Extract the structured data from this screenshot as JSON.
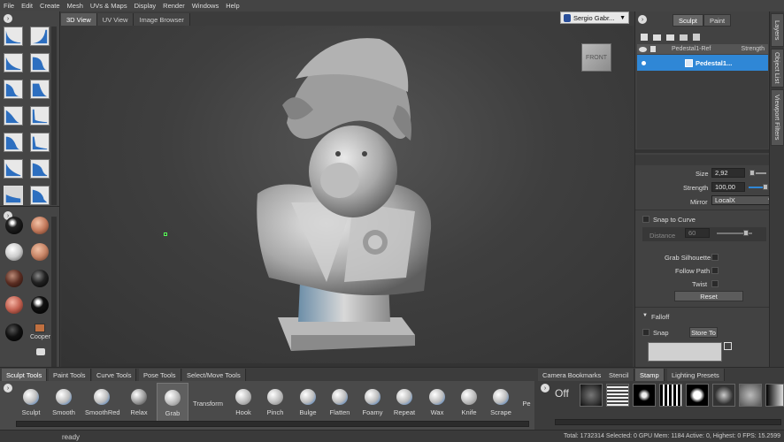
{
  "menu": [
    "File",
    "Edit",
    "Create",
    "Mesh",
    "UVs & Maps",
    "Display",
    "Render",
    "Windows",
    "Help"
  ],
  "view_tabs": [
    "3D View",
    "UV View",
    "Image Browser"
  ],
  "user": {
    "name": "Sergio Gabr..."
  },
  "viewcube": {
    "label": "FRONT"
  },
  "right_tabs": [
    "Sculpt",
    "Paint"
  ],
  "side_tabs": [
    "Layers",
    "Object List",
    "Viewport Filters"
  ],
  "layers": {
    "header_name": "Pedestal1-Ref",
    "header_strength": "Strength",
    "item": "Pedestal1..."
  },
  "props": {
    "size_label": "Size",
    "size_value": "2,92",
    "strength_label": "Strength",
    "strength_value": "100,00",
    "mirror_label": "Mirror",
    "mirror_value": "LocalX",
    "snap_curve_label": "Snap to Curve",
    "distance_label": "Distance",
    "distance_value": "60",
    "grab_sil_label": "Grab Silhouette",
    "follow_path_label": "Follow Path",
    "twist_label": "Twist",
    "reset_label": "Reset",
    "falloff_label": "Falloff",
    "snap_label": "Snap",
    "store_to_label": "Store To"
  },
  "materials": {
    "cooper_label": "Cooper"
  },
  "bottom_tabs": [
    "Sculpt Tools",
    "Paint Tools",
    "Curve Tools",
    "Pose Tools",
    "Select/Move Tools"
  ],
  "stamp_tabs": [
    "Camera Bookmarks",
    "Stencil",
    "Stamp",
    "Lighting Presets"
  ],
  "tools": [
    "Sculpt",
    "Smooth",
    "SmoothRed",
    "Relax",
    "Grab",
    "Transform",
    "Hook",
    "Pinch",
    "Bulge",
    "Flatten",
    "Foamy",
    "Repeat",
    "Wax",
    "Knife",
    "Scrape",
    "Pe"
  ],
  "stamp_off": "Off",
  "status": {
    "left": "ready",
    "right": "Total: 1732314  Selected: 0 GPU Mem: 1184  Active: 0, Highest: 0  FPS: 15.2599"
  }
}
